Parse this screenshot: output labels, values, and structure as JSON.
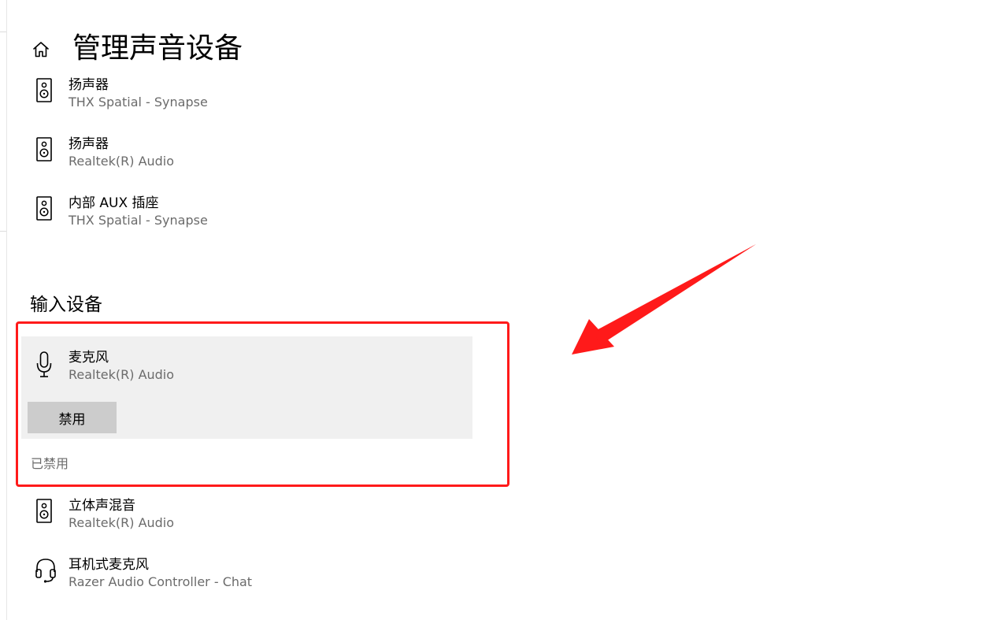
{
  "header": {
    "title": "管理声音设备",
    "home_icon": "home-icon"
  },
  "output_devices": [
    {
      "name": "扬声器",
      "driver": "THX Spatial - Synapse",
      "icon": "speaker-icon"
    },
    {
      "name": "扬声器",
      "driver": "Realtek(R) Audio",
      "icon": "speaker-icon"
    },
    {
      "name": "内部 AUX 插座",
      "driver": "THX Spatial - Synapse",
      "icon": "speaker-icon"
    }
  ],
  "input_section": {
    "heading": "输入设备",
    "selected_device": {
      "name": "麦克风",
      "driver": "Realtek(R) Audio",
      "icon": "microphone-icon",
      "button_label": "禁用"
    },
    "disabled_status": "已禁用",
    "other_devices": [
      {
        "name": "立体声混音",
        "driver": "Realtek(R) Audio",
        "icon": "speaker-icon"
      },
      {
        "name": "耳机式麦克风",
        "driver": "Razer Audio Controller - Chat",
        "icon": "headset-icon"
      }
    ]
  },
  "colors": {
    "annotation_red": "#ff1a1a",
    "selected_background": "#f0f0f0",
    "button_background": "#cccccc",
    "secondary_text": "#6b6b6b"
  }
}
